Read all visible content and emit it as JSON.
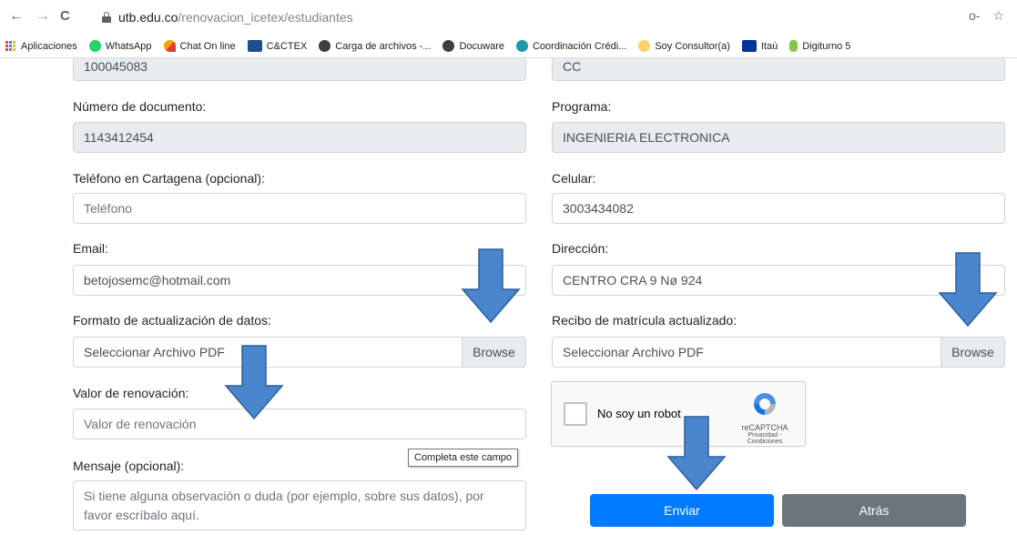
{
  "browser": {
    "url_host": "utb.edu.co",
    "url_path": "/renovacion_icetex/estudiantes",
    "back": "←",
    "forward": "→",
    "reload": "C",
    "key_icon": "o‑",
    "star_icon": "☆"
  },
  "bookmarks": [
    {
      "label": "Aplicaciones",
      "icon": "apps-grid-icon",
      "color": "#4285f4"
    },
    {
      "label": "WhatsApp",
      "icon": "whatsapp-icon",
      "color": "#25d366"
    },
    {
      "label": "Chat On line",
      "icon": "chat-icon",
      "color": "#f4a300"
    },
    {
      "label": "C&CTEX",
      "icon": "cctex-icon",
      "color": "#1d4f91"
    },
    {
      "label": "Carga de archivos -...",
      "icon": "globe-icon",
      "color": "#3c4043"
    },
    {
      "label": "Docuware",
      "icon": "globe-icon",
      "color": "#3c4043"
    },
    {
      "label": "Coordinación Crédi...",
      "icon": "coordinacion-icon",
      "color": "#1a9ba8"
    },
    {
      "label": "Soy Consultor(a)",
      "icon": "consultor-icon",
      "color": "#f6c026"
    },
    {
      "label": "Itaú",
      "icon": "itau-icon",
      "color": "#003399"
    },
    {
      "label": "Digiturno 5",
      "icon": "digiturno-icon",
      "color": "#8bc34a"
    }
  ],
  "form": {
    "top_left_value": "100045083",
    "top_right_value": "CC",
    "numero_label": "Número de documento:",
    "numero_value": "1143412454",
    "programa_label": "Programa:",
    "programa_value": "INGENIERIA ELECTRONICA",
    "telefono_label": "Teléfono en Cartagena (opcional):",
    "telefono_placeholder": "Teléfono",
    "celular_label": "Celular:",
    "celular_value": "3003434082",
    "email_label": "Email:",
    "email_value": "betojosemc@hotmail.com",
    "direccion_label": "Dirección:",
    "direccion_value": "CENTRO CRA 9 Nø 924",
    "formato_label": "Formato de actualización de datos:",
    "formato_file": "Seleccionar Archivo PDF",
    "recibo_label": "Recibo de matrícula actualizado:",
    "recibo_file": "Seleccionar Archivo PDF",
    "browse": "Browse",
    "valor_label": "Valor de renovación:",
    "valor_placeholder": "Valor de renovación",
    "mensaje_label": "Mensaje (opcional):",
    "mensaje_placeholder": "Si tiene alguna observación o duda (por ejemplo, sobre sus datos), por favor escríbalo aquí.",
    "tooltip": "Completa este campo"
  },
  "captcha": {
    "label": "No soy un robot",
    "brand": "reCAPTCHA",
    "links": "Privacidad - Condiciones"
  },
  "buttons": {
    "enviar": "Enviar",
    "atras": "Atrás"
  },
  "colors": {
    "arrow": "#4a86cd",
    "primary": "#007bff",
    "secondary": "#6c757d"
  }
}
